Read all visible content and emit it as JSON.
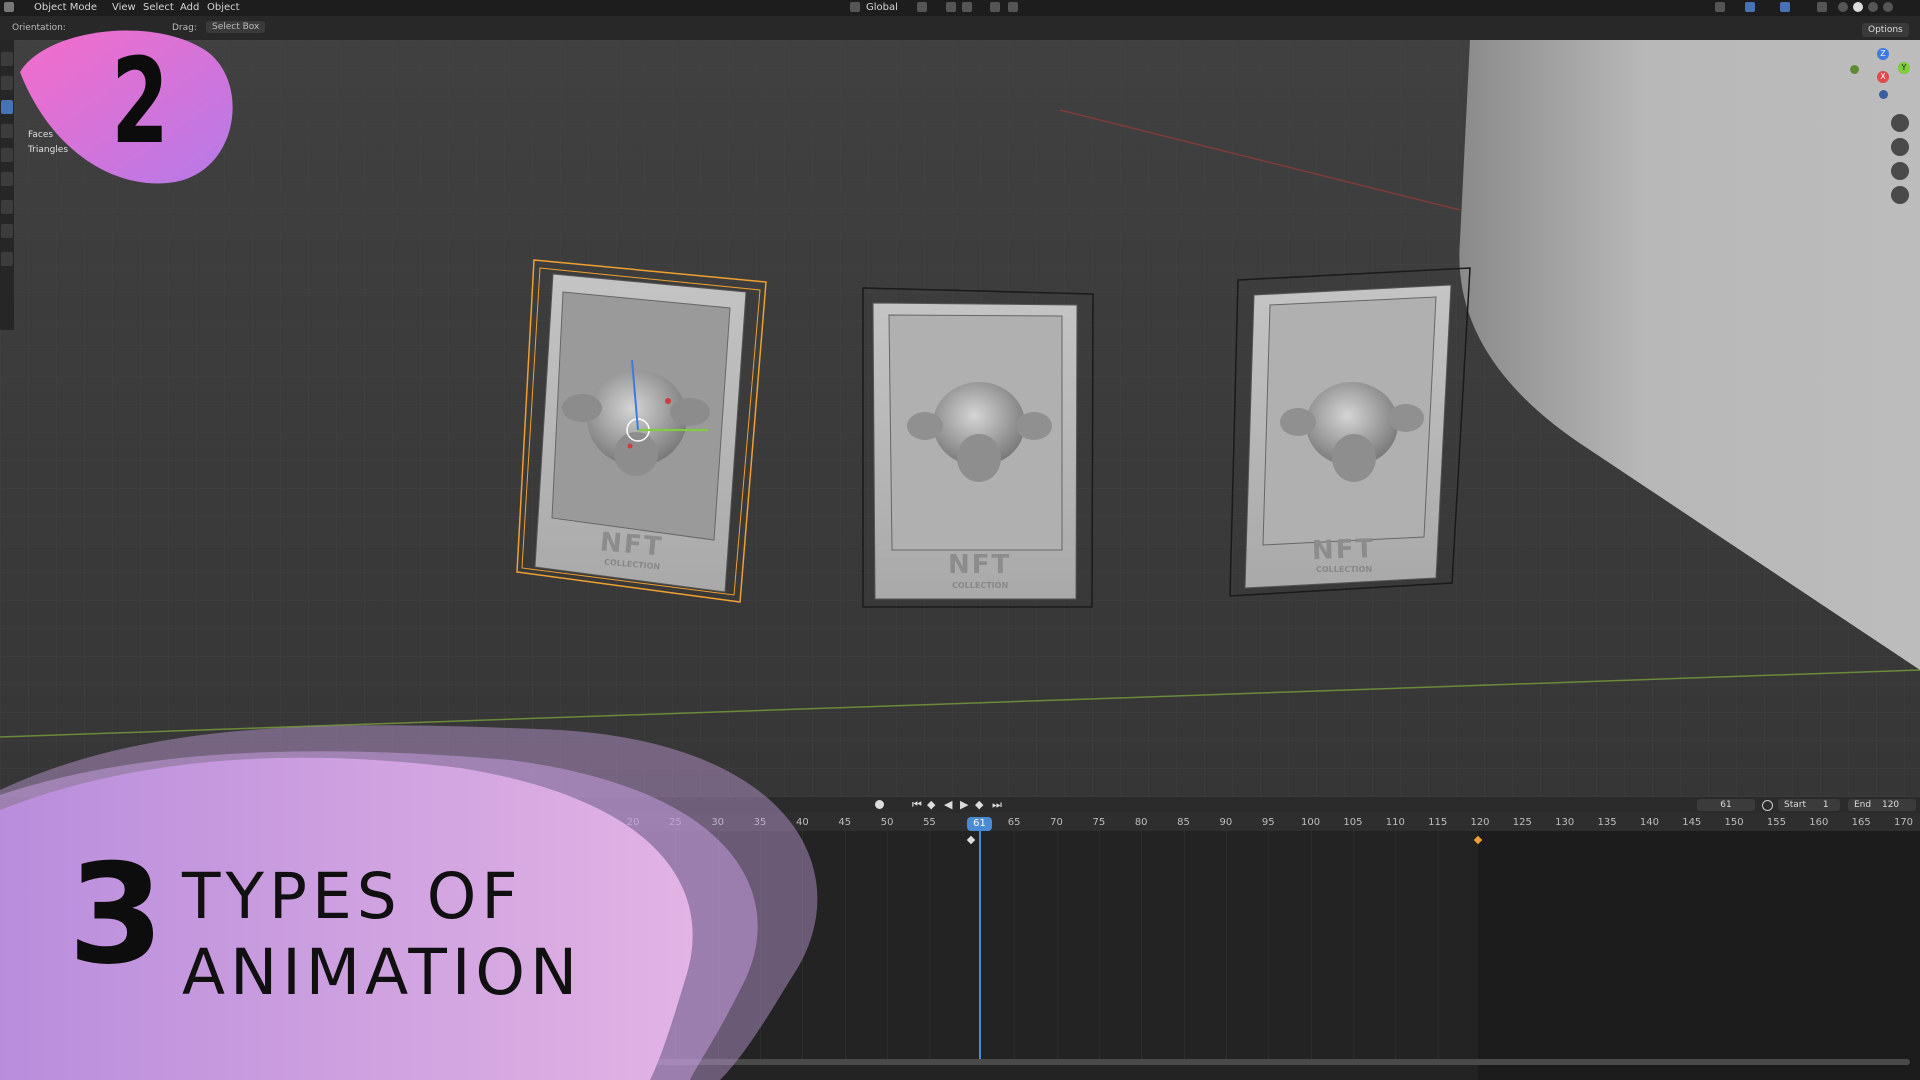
{
  "header": {
    "mode": "Object Mode",
    "menus": [
      "View",
      "Select",
      "Add",
      "Object"
    ],
    "orientation_dropdown": "Global"
  },
  "subheader": {
    "orientation_label": "Orientation:",
    "drag_label": "Drag:",
    "select_box": "Select Box",
    "options_label": "Options"
  },
  "stats": {
    "faces_label": "Faces",
    "triangles_label": "Triangles"
  },
  "viewport": {
    "cards": [
      {
        "title": "NFT",
        "subtitle": "COLLECTION"
      },
      {
        "title": "NFT",
        "subtitle": "COLLECTION"
      },
      {
        "title": "NFT",
        "subtitle": "COLLECTION"
      }
    ],
    "gizmo_axes": [
      "Z",
      "Y",
      "X"
    ]
  },
  "timeline": {
    "current_frame": "61",
    "start_label": "Start",
    "start_value": "1",
    "end_label": "End",
    "end_value": "120",
    "ticks": [
      "20",
      "25",
      "30",
      "35",
      "40",
      "45",
      "50",
      "55",
      "65",
      "70",
      "75",
      "80",
      "85",
      "90",
      "95",
      "100",
      "105",
      "110",
      "115",
      "120",
      "125",
      "130",
      "135",
      "140",
      "145",
      "150",
      "155",
      "160",
      "165",
      "170"
    ],
    "playhead_label": "61"
  },
  "overlay": {
    "badge_number": "2",
    "title_number": "3",
    "title_line1": "TYPES OF",
    "title_line2": "ANIMATION"
  },
  "colors": {
    "accent_blue": "#4a8bd6",
    "selection_orange": "#f0a030",
    "badge_gradient_start": "#f56cc9",
    "badge_gradient_end": "#b57ae8",
    "blob_color": "#c7a1e0"
  }
}
